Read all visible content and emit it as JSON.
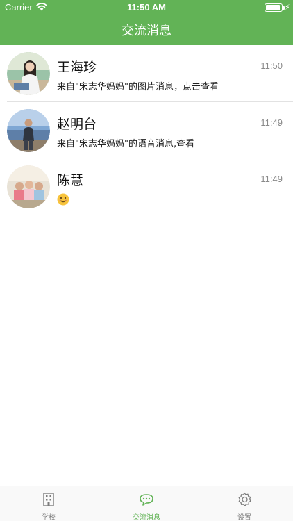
{
  "status_bar": {
    "carrier": "Carrier",
    "time": "11:50 AM"
  },
  "nav": {
    "title": "交流消息"
  },
  "messages": [
    {
      "name": "王海珍",
      "time": "11:50",
      "preview": "来自\"宋志华妈妈\"的图片消息，点击查看",
      "avatar": "avatar-photo-woman"
    },
    {
      "name": "赵明台",
      "time": "11:49",
      "preview": "来自\"宋志华妈妈\"的语音消息,查看",
      "avatar": "avatar-photo-man"
    },
    {
      "name": "陈慧",
      "time": "11:49",
      "preview": "",
      "preview_icon": "smiley-emoji-icon",
      "avatar": "avatar-photo-group"
    }
  ],
  "tabs": [
    {
      "label": "学校",
      "icon": "building-icon",
      "active": false
    },
    {
      "label": "交流消息",
      "icon": "chat-bubbles-icon",
      "active": true
    },
    {
      "label": "设置",
      "icon": "gear-icon",
      "active": false
    }
  ],
  "colors": {
    "accent": "#62b356",
    "inactive": "#7d7d7d",
    "divider": "#e2e2e2"
  }
}
